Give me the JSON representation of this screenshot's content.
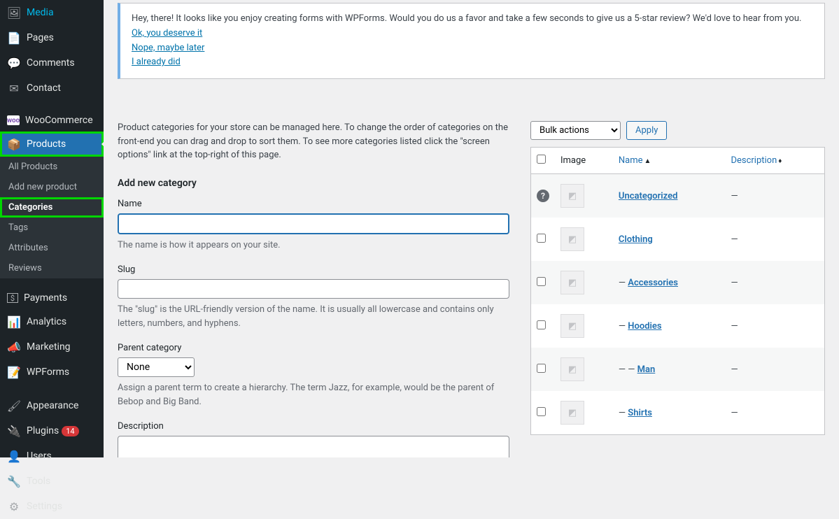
{
  "sidebar": {
    "items": [
      {
        "label": "Media",
        "icon": "🖼"
      },
      {
        "label": "Pages",
        "icon": "📄"
      },
      {
        "label": "Comments",
        "icon": "💬"
      },
      {
        "label": "Contact",
        "icon": "✉"
      },
      {
        "label": "WooCommerce",
        "icon": "W"
      },
      {
        "label": "Products",
        "icon": "📦"
      }
    ],
    "submenu": [
      {
        "label": "All Products"
      },
      {
        "label": "Add new product"
      },
      {
        "label": "Categories"
      },
      {
        "label": "Tags"
      },
      {
        "label": "Attributes"
      },
      {
        "label": "Reviews"
      }
    ],
    "items2": [
      {
        "label": "Payments",
        "icon": "$"
      },
      {
        "label": "Analytics",
        "icon": "📊"
      },
      {
        "label": "Marketing",
        "icon": "📣"
      },
      {
        "label": "WPForms",
        "icon": "📝"
      },
      {
        "label": "Appearance",
        "icon": "🖌"
      },
      {
        "label": "Plugins",
        "icon": "🔌",
        "badge": "14"
      },
      {
        "label": "Users",
        "icon": "👤"
      },
      {
        "label": "Tools",
        "icon": "🔧"
      },
      {
        "label": "Settings",
        "icon": "⚙"
      }
    ]
  },
  "notice": {
    "text": "Hey, there! It looks like you enjoy creating forms with WPForms. Would you do us a favor and take a few seconds to give us a 5-star review? We'd love to hear from you.",
    "links": [
      "Ok, you deserve it",
      "Nope, maybe later",
      "I already did"
    ]
  },
  "intro": "Product categories for your store can be managed here. To change the order of categories on the front-end you can drag and drop to sort them. To see more categories listed click the \"screen options\" link at the top-right of this page.",
  "form": {
    "heading": "Add new category",
    "nameLabel": "Name",
    "nameHelp": "The name is how it appears on your site.",
    "slugLabel": "Slug",
    "slugHelp": "The \"slug\" is the URL-friendly version of the name. It is usually all lowercase and contains only letters, numbers, and hyphens.",
    "parentLabel": "Parent category",
    "parentSelected": "None",
    "parentHelp": "Assign a parent term to create a hierarchy. The term Jazz, for example, would be the parent of Bebop and Big Band.",
    "descLabel": "Description"
  },
  "table": {
    "bulkLabel": "Bulk actions",
    "applyLabel": "Apply",
    "headers": {
      "image": "Image",
      "name": "Name",
      "description": "Description"
    },
    "rows": [
      {
        "name": "Uncategorized",
        "desc": "—",
        "indent": 0,
        "default": true
      },
      {
        "name": "Clothing",
        "desc": "—",
        "indent": 0
      },
      {
        "name": "Accessories",
        "desc": "—",
        "indent": 1
      },
      {
        "name": "Hoodies",
        "desc": "—",
        "indent": 1
      },
      {
        "name": "Man",
        "desc": "—",
        "indent": 2
      },
      {
        "name": "Shirts",
        "desc": "—",
        "indent": 1
      }
    ]
  }
}
